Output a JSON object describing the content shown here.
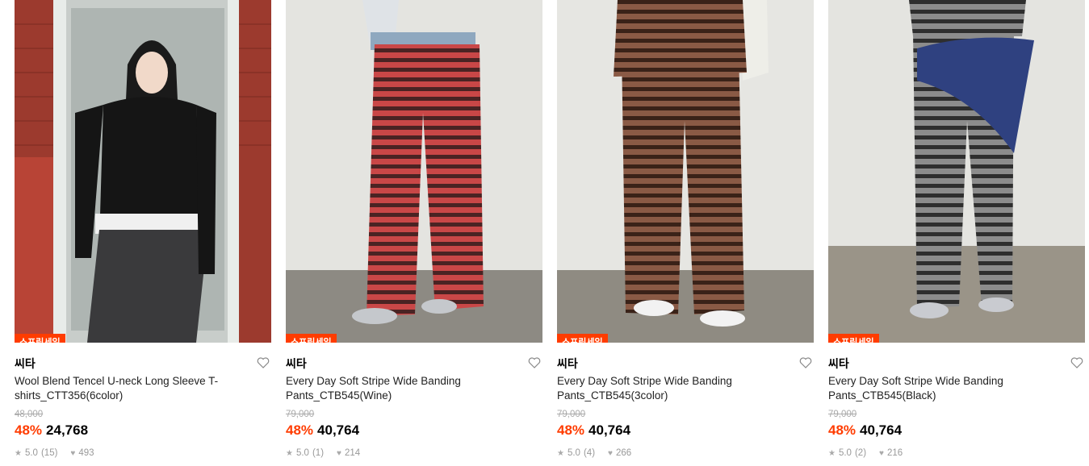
{
  "products": [
    {
      "badge": "스프링세일",
      "brand": "씨타",
      "title": "Wool Blend Tencel U-neck Long Sleeve T-shirts_CTT356(6color)",
      "original_price": "48,000",
      "discount": "48%",
      "price": "24,768",
      "rating": "5.0",
      "reviews": "(15)",
      "likes": "493",
      "image_type": "model-in-doorway",
      "stripe_colors": []
    },
    {
      "badge": "스프링세일",
      "brand": "씨타",
      "title": "Every Day Soft Stripe Wide Banding Pants_CTB545(Wine)",
      "original_price": "79,000",
      "discount": "48%",
      "price": "40,764",
      "rating": "5.0",
      "reviews": "(1)",
      "likes": "214",
      "image_type": "striped-pants",
      "stripe_colors": [
        "#c94747",
        "#4a2323"
      ]
    },
    {
      "badge": "스프링세일",
      "brand": "씨타",
      "title": "Every Day Soft Stripe Wide Banding Pants_CTB545(3color)",
      "original_price": "79,000",
      "discount": "48%",
      "price": "40,764",
      "rating": "5.0",
      "reviews": "(4)",
      "likes": "266",
      "image_type": "striped-pants",
      "stripe_colors": [
        "#8a5a45",
        "#3a2218"
      ]
    },
    {
      "badge": "스프링세일",
      "brand": "씨타",
      "title": "Every Day Soft Stripe Wide Banding Pants_CTB545(Black)",
      "original_price": "79,000",
      "discount": "48%",
      "price": "40,764",
      "rating": "5.0",
      "reviews": "(2)",
      "likes": "216",
      "image_type": "striped-pants-scarf",
      "stripe_colors": [
        "#8c8c8c",
        "#2e2e2e"
      ]
    }
  ],
  "colors": {
    "accent": "#ff3c00",
    "muted": "#999999"
  },
  "icons": {
    "heart": "heart-outline-icon",
    "star": "star-icon",
    "likes": "heart-filled-icon"
  }
}
